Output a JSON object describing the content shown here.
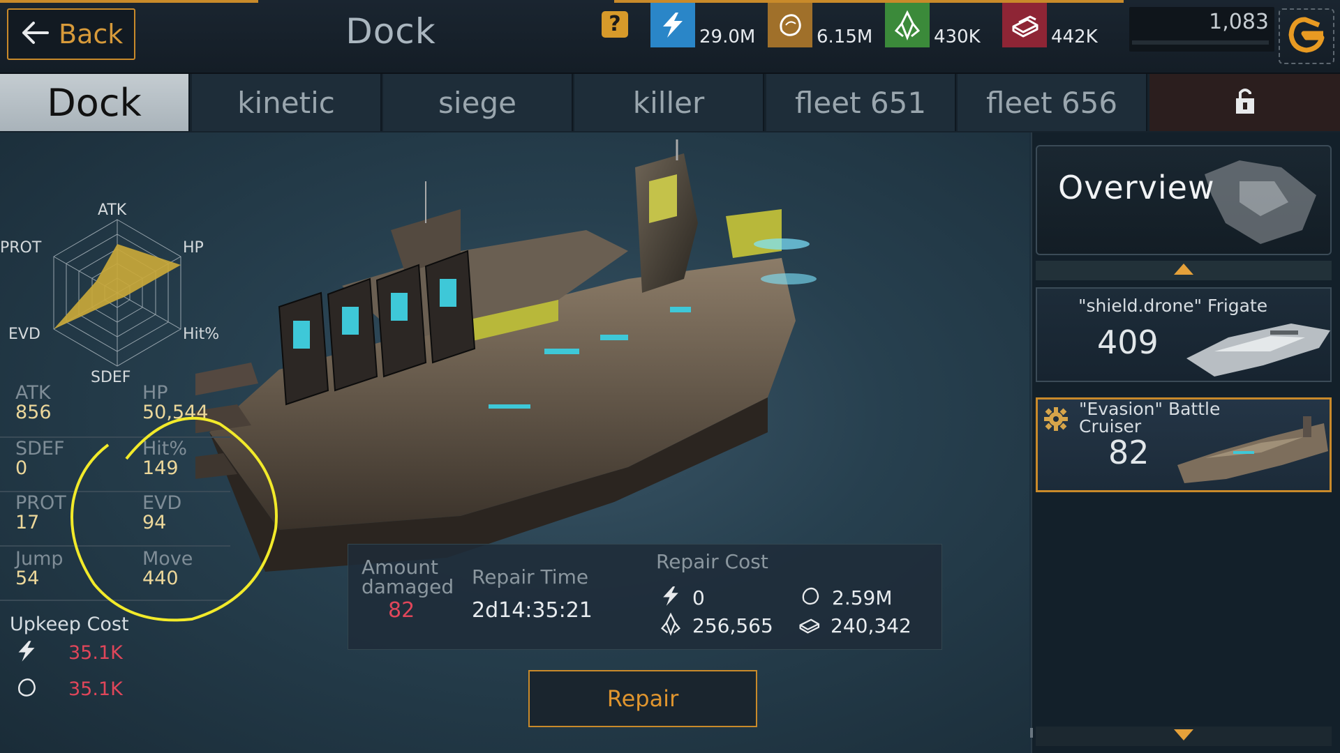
{
  "header": {
    "back_label": "Back",
    "title": "Dock",
    "help_symbol": "?",
    "resources": [
      {
        "icon": "energy-icon",
        "value": "29.0M",
        "color": "#2a86c8"
      },
      {
        "icon": "ore-icon",
        "value": "6.15M",
        "color": "#b07a2a"
      },
      {
        "icon": "crystal-icon",
        "value": "430K",
        "color": "#3b8a3a"
      },
      {
        "icon": "alloy-icon",
        "value": "442K",
        "color": "#9a2a3a"
      }
    ],
    "currency_value": "1,083",
    "shop_icon": "shop-g-icon"
  },
  "tabs": [
    {
      "label": "Dock",
      "active": true
    },
    {
      "label": "kinetic"
    },
    {
      "label": "siege"
    },
    {
      "label": "killer"
    },
    {
      "label": "fleet 651"
    },
    {
      "label": "fleet 656"
    }
  ],
  "radar": {
    "labels": {
      "atk": "ATK",
      "hp": "HP",
      "hit": "Hit%",
      "sdef": "SDEF",
      "evd": "EVD",
      "prot": "PROT"
    },
    "fill_color": "#c9a83a"
  },
  "stats": [
    {
      "k1": "ATK",
      "v1": "856",
      "k2": "HP",
      "v2": "50,544"
    },
    {
      "k1": "SDEF",
      "v1": "0",
      "k2": "Hit%",
      "v2": "149"
    },
    {
      "k1": "PROT",
      "v1": "17",
      "k2": "EVD",
      "v2": "94"
    },
    {
      "k1": "Jump",
      "v1": "54",
      "k2": "Move",
      "v2": "440"
    }
  ],
  "upkeep": {
    "title": "Upkeep Cost",
    "items": [
      {
        "icon": "energy-icon",
        "value": "35.1K"
      },
      {
        "icon": "ore-icon",
        "value": "35.1K"
      }
    ]
  },
  "repair": {
    "amount_label_1": "Amount",
    "amount_label_2": "damaged",
    "amount_value": "82",
    "time_label": "Repair Time",
    "time_value": "2d14:35:21",
    "cost_label": "Repair Cost",
    "costs": [
      {
        "icon": "energy-icon",
        "value": "0"
      },
      {
        "icon": "ore-icon",
        "value": "2.59M"
      },
      {
        "icon": "crystal-icon",
        "value": "256,565"
      },
      {
        "icon": "alloy-icon",
        "value": "240,342"
      }
    ],
    "button_label": "Repair"
  },
  "sidebar": {
    "overview_label": "Overview",
    "ships": [
      {
        "name": "\"shield.drone\" Frigate",
        "level": "409",
        "selected": false
      },
      {
        "name_line1": "\"Evasion\" Battle",
        "name_line2": "Cruiser",
        "level": "82",
        "selected": true
      }
    ]
  }
}
